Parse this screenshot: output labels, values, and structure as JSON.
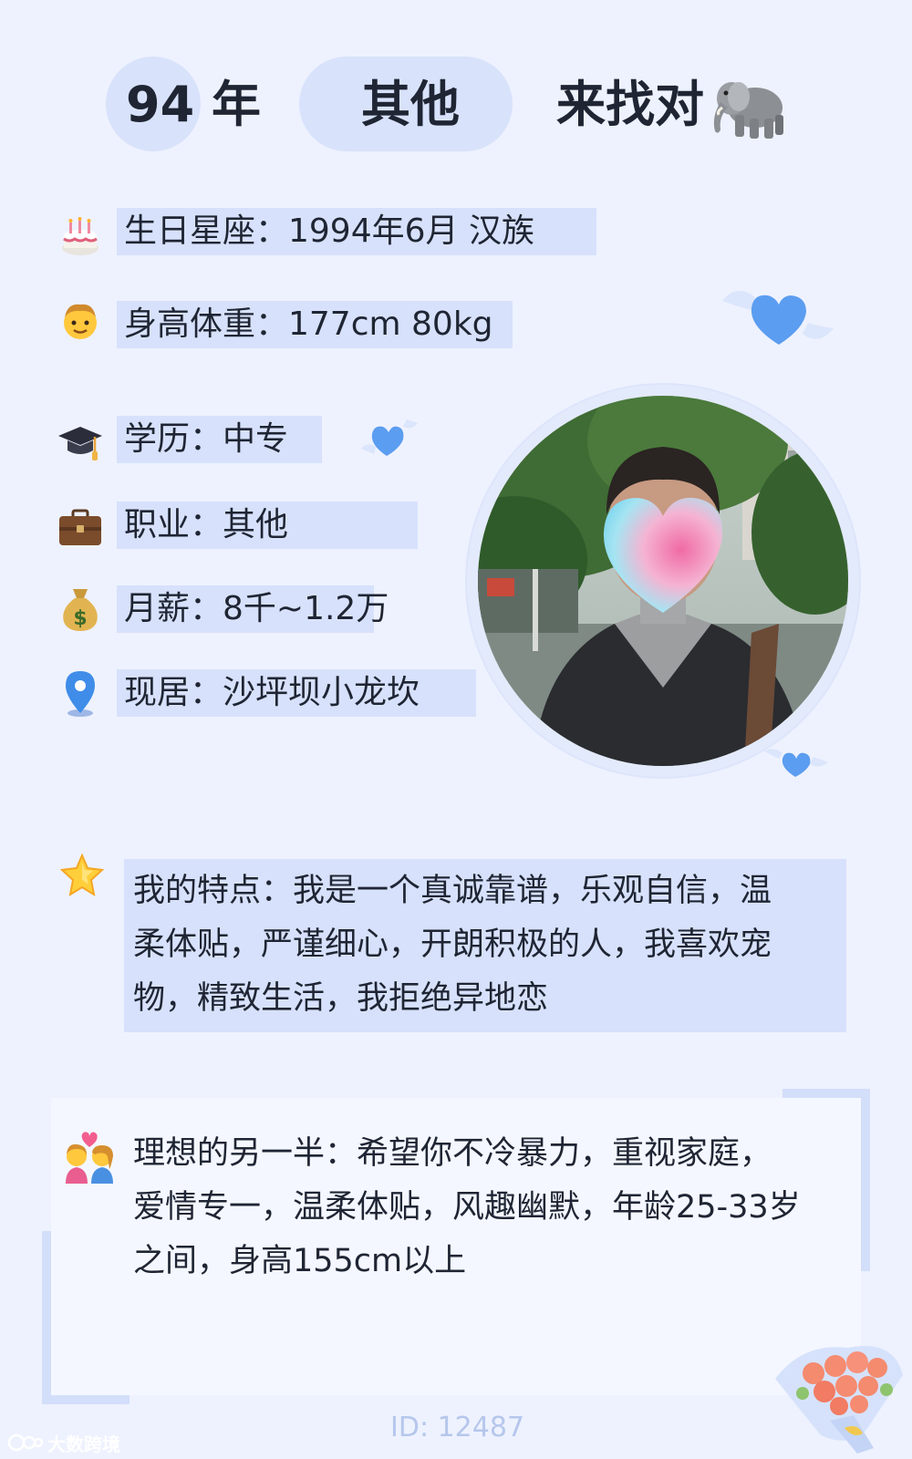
{
  "header": {
    "year": "94",
    "year_suffix": "年",
    "zodiac": "其他",
    "seeking": "来找对"
  },
  "info_rows": [
    {
      "icon": "birthday-cake-icon",
      "text": "生日星座：1994年6月 汉族"
    },
    {
      "icon": "man-face-icon",
      "text": "身高体重：177cm 80kg"
    },
    {
      "icon": "graduation-cap-icon",
      "text": "学历：中专"
    },
    {
      "icon": "briefcase-icon",
      "text": "职业：其他"
    },
    {
      "icon": "money-bag-icon",
      "text": "月薪：8千~1.2万"
    },
    {
      "icon": "location-pin-icon",
      "text": "现居：沙坪坝小龙坎"
    }
  ],
  "features": {
    "icon": "glowing-star-icon",
    "lines": [
      "我的特点：我是一个真诚靠谱，乐观自信，温",
      "柔体贴，严谨细心，开朗积极的人，我喜欢宠",
      "物，精致生活，我拒绝异地恋"
    ]
  },
  "ideal_partner": {
    "icon": "couple-with-heart-icon",
    "lines": [
      "理想的另一半：希望你不冷暴力，重视家庭，",
      "爱情专一，温柔体贴，风趣幽默，年龄25-33岁",
      "之间，身高155cm以上"
    ]
  },
  "footer": {
    "id_text": "ID: 12487",
    "watermark": "大数跨境"
  },
  "colors": {
    "background": "#eef2fe",
    "highlight": "#d7e1fb",
    "heart": "#5b9df0"
  }
}
